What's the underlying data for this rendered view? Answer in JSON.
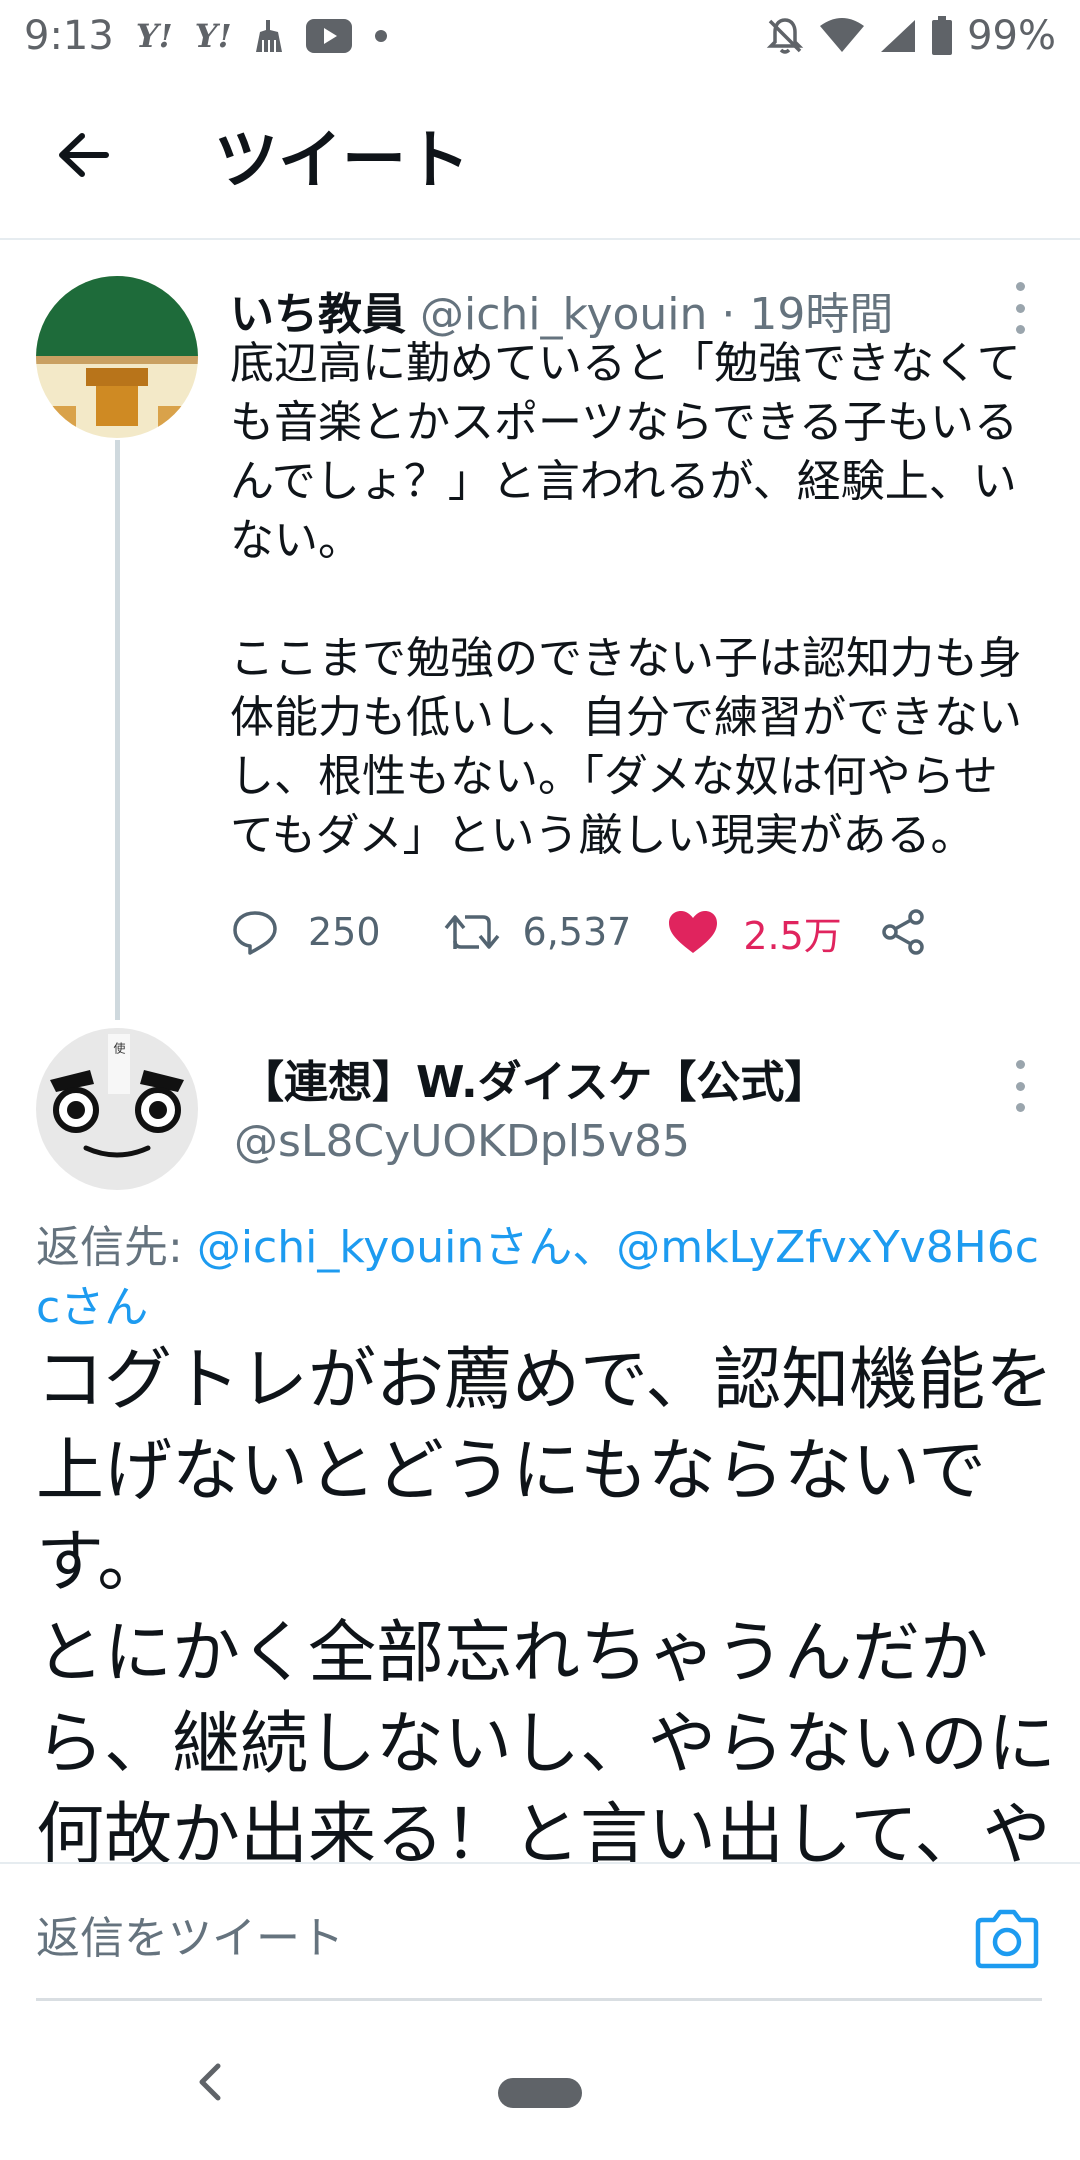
{
  "status_bar": {
    "time": "9:13",
    "yahoo1": "Y!",
    "yahoo2": "Y!",
    "battery_percent": "99%",
    "icons": [
      "yahoo-icon",
      "yahoo-icon",
      "clean-icon",
      "youtube-icon",
      "dot-icon",
      "notification-off-icon",
      "wifi-icon",
      "signal-icon",
      "battery-icon"
    ]
  },
  "app_bar": {
    "title": "ツイート",
    "back_icon": "back-arrow-icon"
  },
  "tweet1": {
    "name": "いち教員",
    "handle": "@ichi_kyouin",
    "time": "· 19時間",
    "text": "底辺高に勤めていると「勉強できなくて\nも音楽とかスポーツならできる子もいる\nんでしょ？」と言われるが、経験上、い\nない。\n\nここまで勉強のできない子は認知力も身\n体能力も低いし、自分で練習ができない\nし、根性もない。「ダメな奴は何やらせ\nてもダメ」という厳しい現実がある。",
    "replies": "250",
    "retweets": "6,537",
    "likes": "2.5万"
  },
  "tweet2": {
    "name": "【連想】W.ダイスケ【公式】",
    "handle": "@sL8CyUOKDpl5v85",
    "reply_prefix": "返信先: ",
    "reply_users": "@ichi_kyouinさん、@mkLyZfvxYv8H6ccさん",
    "text": "コグトレがお薦めで、認知機能を\n上げないとどうにもならないで\nす。\nとにかく全部忘れちゃうんだか\nら、継続しないし、やらないのに\n何故か出来る！と言い出して、や"
  },
  "composer": {
    "placeholder": "返信をツイート",
    "camera_icon": "camera-icon"
  },
  "colors": {
    "like": "#e0245e",
    "link": "#1d9bf0",
    "muted": "#65737e",
    "text": "#0f1419",
    "border": "#e6ecf0"
  }
}
